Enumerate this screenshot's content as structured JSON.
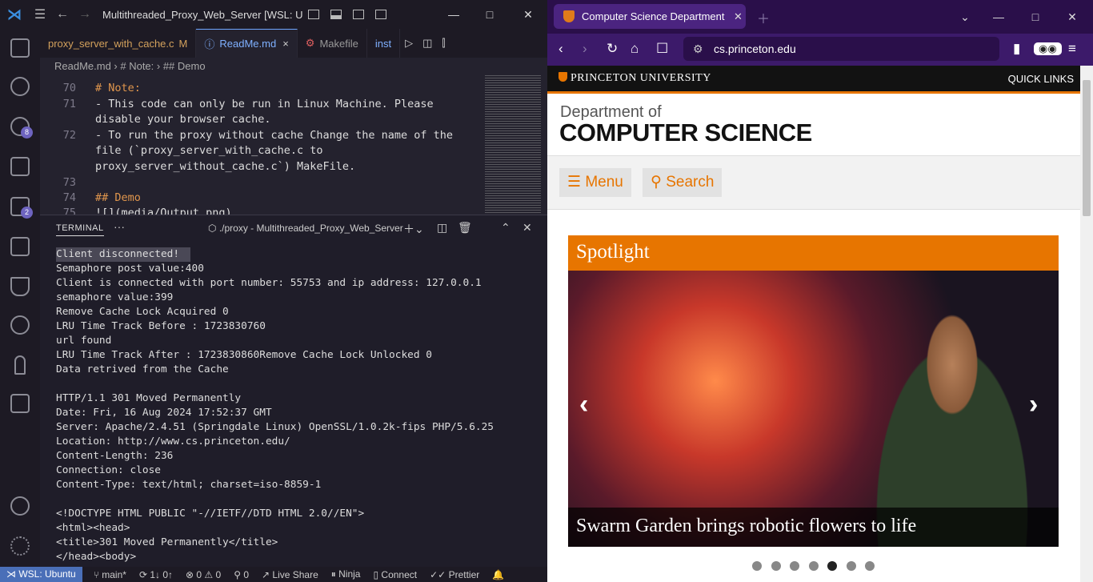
{
  "vscode": {
    "window_title": "Multithreaded_Proxy_Web_Server [WSL: Ubur",
    "nav_back": "←",
    "nav_fwd": "→",
    "tabs": [
      {
        "label": "proxy_server_with_cache.c",
        "modified": "M"
      },
      {
        "label": "ReadMe.md",
        "close": "×"
      },
      {
        "label": "Makefile"
      },
      {
        "label": "inst"
      }
    ],
    "breadcrumb": "ReadMe.md  ›  # Note:  ›  ## Demo",
    "editor_lines": [
      {
        "n": "70",
        "text": "# Note:"
      },
      {
        "n": "71",
        "text": "- This code can only be run in Linux Machine. Please"
      },
      {
        "n": "",
        "text": "disable your browser cache."
      },
      {
        "n": "72",
        "text": "- To run the proxy without cache Change the name of the"
      },
      {
        "n": "",
        "text": "file (`proxy_server_with_cache.c to"
      },
      {
        "n": "",
        "text": "proxy_server_without_cache.c`) MakeFile."
      },
      {
        "n": "73",
        "text": ""
      },
      {
        "n": "74",
        "text": "## Demo"
      },
      {
        "n": "75",
        "text": "![](media/Output.png)"
      }
    ],
    "badges": {
      "source_control": "8",
      "extensions": "2"
    },
    "panel": {
      "title": "TERMINAL",
      "more": "···",
      "terminal_name": "./proxy - Multithreaded_Proxy_Web_Server"
    },
    "terminal_lines": [
      "Client disconnected!",
      "Semaphore post value:400",
      "Client is connected with port number: 55753 and ip address: 127.0.0.1",
      "semaphore value:399",
      "Remove Cache Lock Acquired 0",
      "LRU Time Track Before : 1723830760",
      "url found",
      "LRU Time Track After : 1723830860Remove Cache Lock Unlocked 0",
      "Data retrived from the Cache",
      "",
      "HTTP/1.1 301 Moved Permanently",
      "Date: Fri, 16 Aug 2024 17:52:37 GMT",
      "Server: Apache/2.4.51 (Springdale Linux) OpenSSL/1.0.2k-fips PHP/5.6.25",
      "Location: http://www.cs.princeton.edu/",
      "Content-Length: 236",
      "Connection: close",
      "Content-Type: text/html; charset=iso-8859-1",
      "",
      "<!DOCTYPE HTML PUBLIC \"-//IETF//DTD HTML 2.0//EN\">",
      "<html><head>",
      "<title>301 Moved Permanently</title>",
      "</head><body>"
    ],
    "status": {
      "remote": "WSL: Ubuntu",
      "branch": "main*",
      "sync": "1↓ 0↑",
      "problems": "⊗ 0 ⚠ 0",
      "ports": "0",
      "live_share": "Live Share",
      "ninja": "Ninja",
      "connect": "Connect",
      "prettier": "Prettier"
    }
  },
  "browser": {
    "tab_title": "Computer Science Department",
    "url": "cs.princeton.edu",
    "brave_count": "2",
    "princeton_logo": "PRINCETON UNIVERSITY",
    "quick_links": "QUICK LINKS",
    "dept_of": "Department of",
    "dept_name": "COMPUTER SCIENCE",
    "menu_label": "Menu",
    "search_label": "Search",
    "spotlight_label": "Spotlight",
    "caption": "Swarm Garden brings robotic flowers to life",
    "slide_count": 7,
    "active_slide": 5,
    "colors": {
      "princeton_orange": "#e77500",
      "tab_bar": "#2a0f4a",
      "nav_bar": "#3c1a6a"
    }
  }
}
